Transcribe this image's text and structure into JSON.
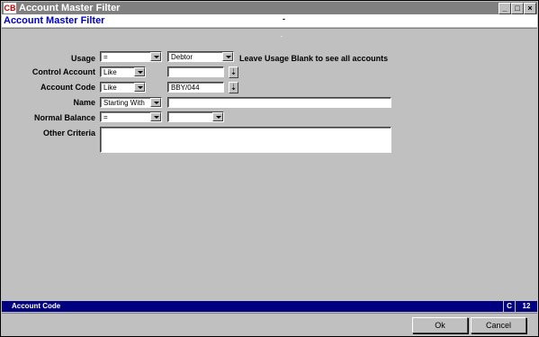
{
  "window": {
    "title": "Account Master Filter",
    "app_icon_text": "CB",
    "controls": [
      "_",
      "□",
      "×"
    ]
  },
  "header": {
    "title": "Account Master Filter"
  },
  "form": {
    "usage": {
      "label": "Usage",
      "operator": "=",
      "value": "Debtor",
      "hint": "Leave Usage Blank to see all accounts"
    },
    "control_account": {
      "label": "Control Account",
      "operator": "Like",
      "value": ""
    },
    "account_code": {
      "label": "Account Code",
      "operator": "Like",
      "value": "BBY/044"
    },
    "name": {
      "label": "Name",
      "operator": "Starting With",
      "value": ""
    },
    "normal_balance": {
      "label": "Normal Balance",
      "operator": "=",
      "value": ""
    },
    "other_criteria": {
      "label": "Other Criteria",
      "value": ""
    }
  },
  "status": {
    "text": "Account Code",
    "mode": "C",
    "count": "12"
  },
  "buttons": {
    "ok": "Ok",
    "cancel": "Cancel"
  }
}
